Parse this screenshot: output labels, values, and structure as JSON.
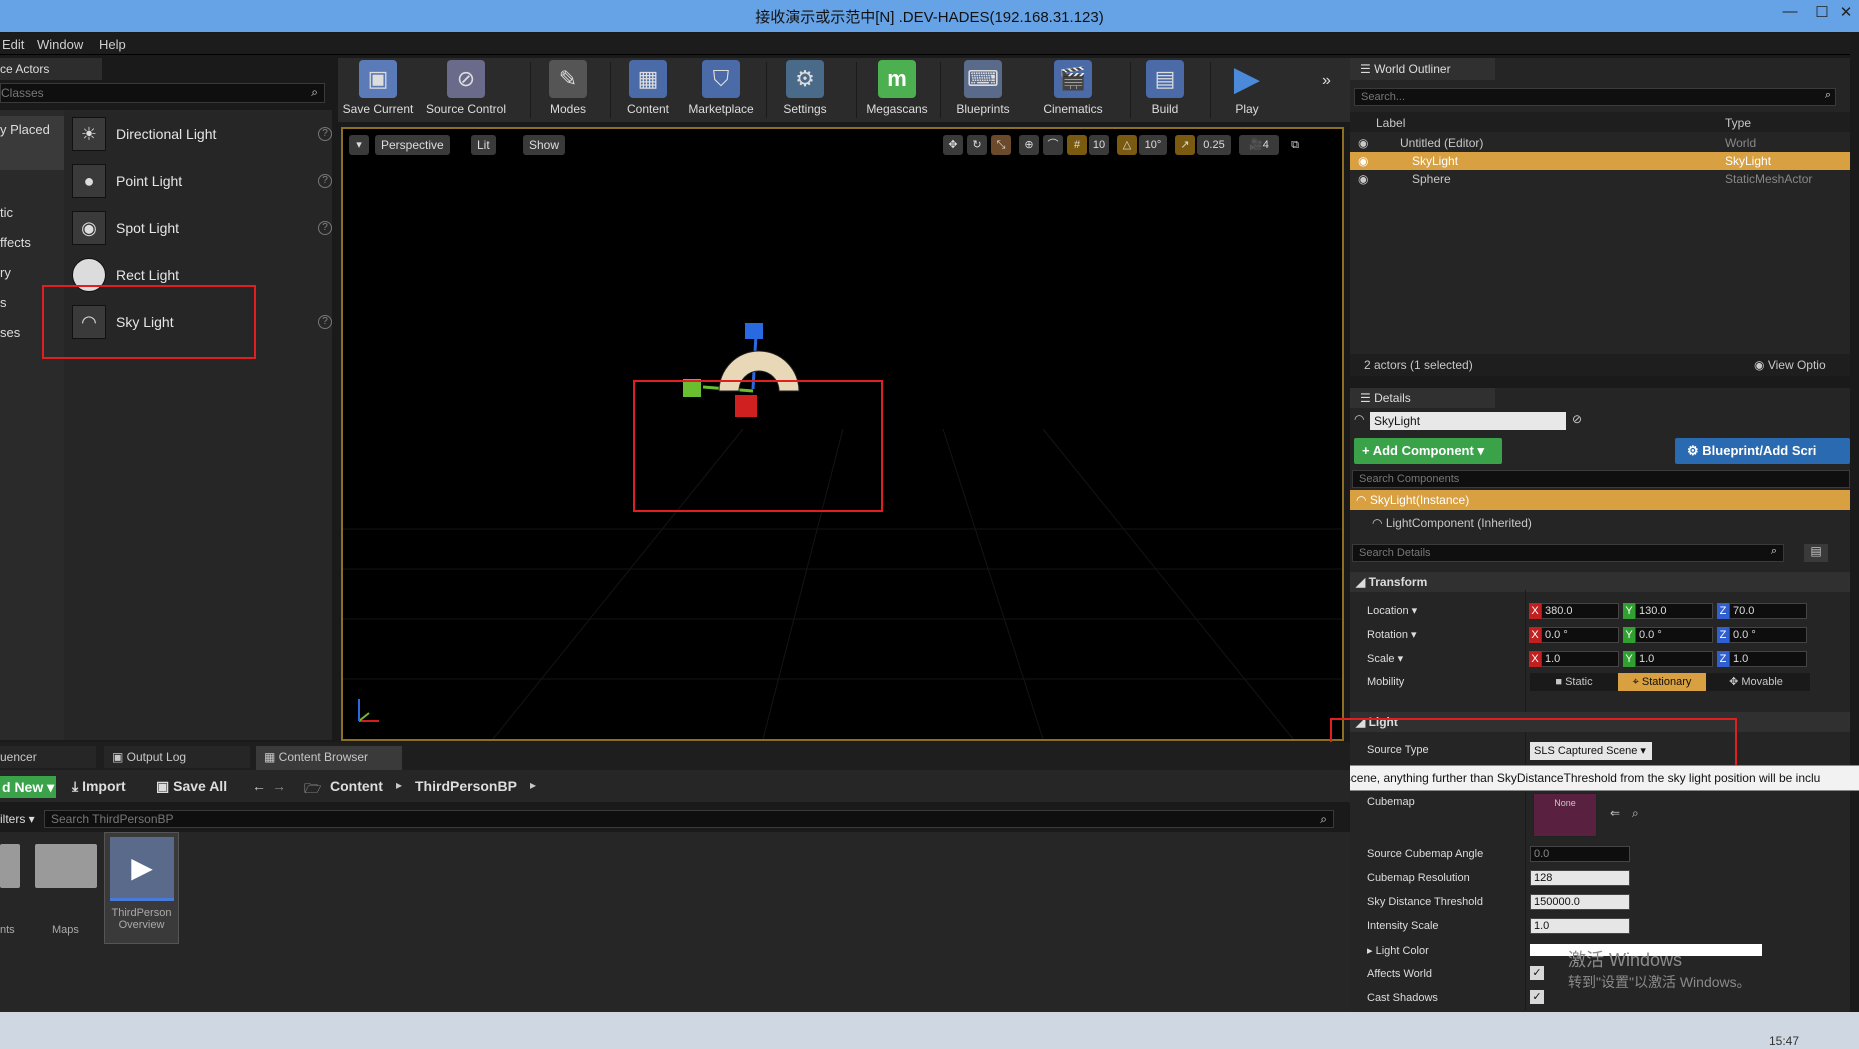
{
  "window": {
    "title": "接收演示或示范中[N] .DEV-HADES(192.168.31.123)",
    "controls": [
      "—",
      "☐",
      "✕"
    ]
  },
  "menu": [
    "Edit",
    "Window",
    "Help"
  ],
  "left": {
    "tab": "ce Actors",
    "search_placeholder": "Classes",
    "categories": [
      "y Placed",
      "tic",
      "ffects",
      "ry",
      "s",
      "ses"
    ],
    "actors": [
      {
        "label": "Directional Light",
        "icon": "directional-light-icon"
      },
      {
        "label": "Point Light",
        "icon": "point-light-icon"
      },
      {
        "label": "Spot Light",
        "icon": "spot-light-icon"
      },
      {
        "label": "Rect Light",
        "icon": "rect-light-icon"
      },
      {
        "label": "Sky Light",
        "icon": "sky-light-icon"
      }
    ]
  },
  "toolbar": [
    {
      "label": "Save Current",
      "icon": "save-icon",
      "color": "#5a7ab8"
    },
    {
      "label": "Source Control",
      "icon": "source-control-icon",
      "color": "#6a6a8a"
    },
    {
      "label": "Modes",
      "icon": "modes-icon",
      "color": "#555555"
    },
    {
      "label": "Content",
      "icon": "content-icon",
      "color": "#4a6aa8"
    },
    {
      "label": "Marketplace",
      "icon": "marketplace-icon",
      "color": "#4a6aa8"
    },
    {
      "label": "Settings",
      "icon": "settings-icon",
      "color": "#4a6a8a"
    },
    {
      "label": "Megascans",
      "icon": "megascans-icon",
      "color": "#4caf50"
    },
    {
      "label": "Blueprints",
      "icon": "blueprints-icon",
      "color": "#5a6a8a"
    },
    {
      "label": "Cinematics",
      "icon": "cinematics-icon",
      "color": "#4a6aa8"
    },
    {
      "label": "Build",
      "icon": "build-icon",
      "color": "#4a6aa8"
    },
    {
      "label": "Play",
      "icon": "play-icon",
      "color": "#4a8ad8"
    }
  ],
  "viewport": {
    "perspective": "Perspective",
    "lit": "Lit",
    "show": "Show",
    "grid_snap": "10",
    "rot_snap": "10°",
    "scale_snap": "0.25",
    "cam_speed": "4"
  },
  "outliner": {
    "tab": "World Outliner",
    "search_placeholder": "Search...",
    "col_label": "Label",
    "col_type": "Type",
    "rows": [
      {
        "label": "Untitled (Editor)",
        "type": "World"
      },
      {
        "label": "SkyLight",
        "type": "SkyLight"
      },
      {
        "label": "Sphere",
        "type": "StaticMeshActor"
      }
    ],
    "status": "2 actors (1 selected)",
    "view_options": "View Optio"
  },
  "details": {
    "tab": "Details",
    "name": "SkyLight",
    "add_component": "+ Add Component",
    "blueprint": "Blueprint/Add Scri",
    "search_components": "Search Components",
    "instance": "SkyLight(Instance)",
    "light_component": "LightComponent (Inherited)",
    "search_details": "Search Details",
    "transform_header": "Transform",
    "location_label": "Location",
    "rotation_label": "Rotation",
    "scale_label": "Scale",
    "location": [
      "380.0",
      "130.0",
      "70.0"
    ],
    "rotation": [
      "0.0 °",
      "0.0 °",
      "0.0 °"
    ],
    "scale": [
      "1.0",
      "1.0",
      "1.0"
    ],
    "axes": [
      "X",
      "Y",
      "Z"
    ],
    "mobility_label": "Mobility",
    "mobility": [
      "Static",
      "Stationary",
      "Movable"
    ],
    "light_header": "Light",
    "source_type_label": "Source Type",
    "source_type": "SLS Captured Scene",
    "cubemap_label": "Cubemap",
    "cubemap_value": "None",
    "props": [
      {
        "label": "Source Cubemap Angle",
        "value": "0.0"
      },
      {
        "label": "Cubemap Resolution",
        "value": "128"
      },
      {
        "label": "Sky Distance Threshold",
        "value": "150000.0"
      },
      {
        "label": "Intensity Scale",
        "value": "1.0"
      }
    ],
    "light_color_label": "Light Color",
    "affects_world_label": "Affects World",
    "cast_shadows_label": "Cast Shadows"
  },
  "tooltip": "Construct the sky light from the captured scene, anything further than SkyDistanceThreshold from the sky light position will be inclu",
  "bottom": {
    "tabs": [
      "uencer",
      "Output Log",
      "Content Browser"
    ],
    "add_new": "d New",
    "import": "Import",
    "save_all": "Save All",
    "path": [
      "Content",
      "ThirdPersonBP"
    ],
    "filters": "ilters",
    "search_placeholder": "Search ThirdPersonBP",
    "assets": [
      {
        "label": "nts"
      },
      {
        "label": "Maps"
      },
      {
        "label": "ThirdPerson Overview"
      }
    ]
  },
  "watermark": {
    "line1": "激活 Windows",
    "line2": "转到\"设置\"以激活 Windows。"
  },
  "clock": "15:47"
}
